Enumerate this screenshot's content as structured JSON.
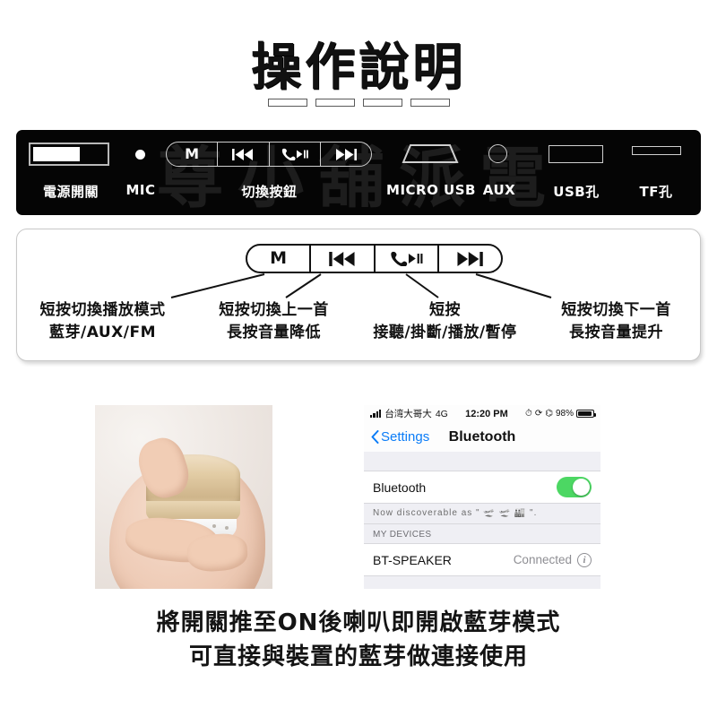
{
  "title": {
    "heading": "操作說明",
    "underbar_count": 4
  },
  "device_bar": {
    "watermark": "尊小舖派電",
    "items": [
      {
        "label": "電源開關",
        "icon": "power-switch-icon"
      },
      {
        "label": "MIC",
        "icon": "microphone-dot-icon"
      },
      {
        "label": "切換按鈕",
        "icon": "control-buttons-icon"
      },
      {
        "label": "MICRO USB",
        "icon": "micro-usb-port-icon"
      },
      {
        "label": "AUX",
        "icon": "aux-jack-icon"
      },
      {
        "label": "USB孔",
        "icon": "usb-port-icon"
      },
      {
        "label": "TF孔",
        "icon": "tf-card-slot-icon"
      }
    ]
  },
  "buttons": {
    "keys": [
      {
        "glyph": "M",
        "icon": "mode-m-icon"
      },
      {
        "glyph": "prev",
        "icon": "previous-track-icon"
      },
      {
        "glyph": "call-play",
        "icon": "call-play-pause-icon"
      },
      {
        "glyph": "next",
        "icon": "next-track-icon"
      }
    ],
    "captions": [
      {
        "line1": "短按切換播放模式",
        "line2": "藍芽/AUX/FM"
      },
      {
        "line1": "短按切換上一首",
        "line2": "長按音量降低"
      },
      {
        "line1": "短按",
        "line2": "接聽/掛斷/播放/暫停"
      },
      {
        "line1": "短按切換下一首",
        "line2": "長按音量提升"
      }
    ]
  },
  "photo": {
    "alt": "hand-holding-gold-bluetooth-speaker"
  },
  "phone": {
    "status": {
      "carrier": "台湾大哥大",
      "network": "4G",
      "time": "12:20 PM",
      "battery_percent": "98%",
      "icons": [
        "alarm-icon",
        "rotation-lock-icon",
        "headphones-icon"
      ]
    },
    "nav": {
      "back_label": "Settings",
      "title": "Bluetooth"
    },
    "bluetooth_row": {
      "label": "Bluetooth",
      "toggle_state": "on"
    },
    "discoverable_note": "Now discoverable as \" 🛫 🛫 🏭 \".",
    "section_header": "MY DEVICES",
    "device": {
      "name": "BT-SPEAKER",
      "status": "Connected",
      "info_glyph": "i"
    }
  },
  "bottom_caption": {
    "line1": "將開關推至ON後喇叭即開啟藍芽模式",
    "line2": "可直接與裝置的藍芽做連接使用"
  },
  "colors": {
    "device_bar_bg": "#050505",
    "toggle_on": "#4cd763",
    "ios_blue": "#0a7cf7",
    "ios_group_bg": "#efeff4"
  }
}
